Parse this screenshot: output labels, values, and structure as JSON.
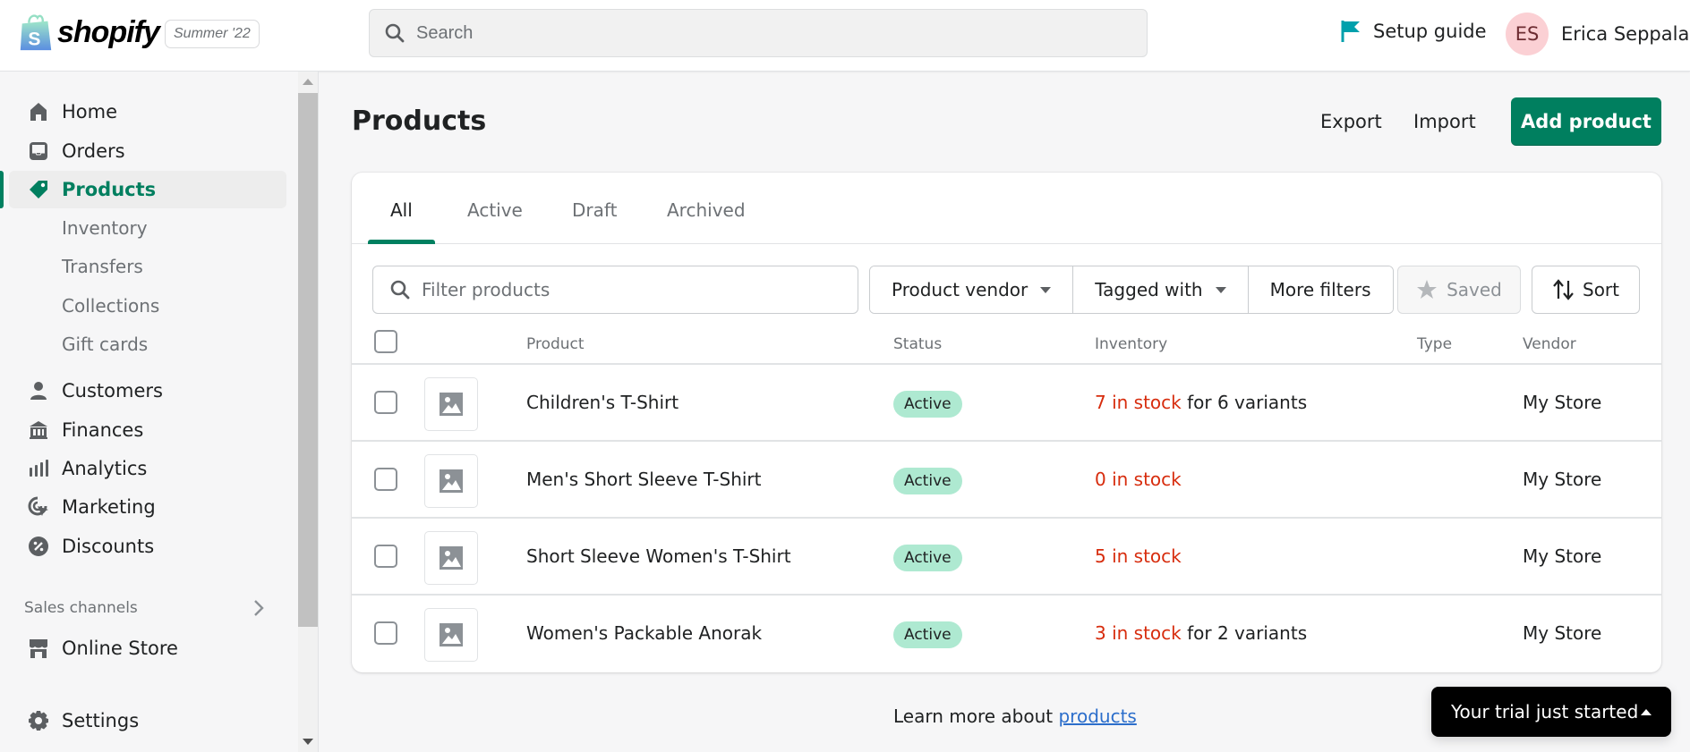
{
  "topbar": {
    "brand": "shopify",
    "version_badge": "Summer '22",
    "search_placeholder": "Search",
    "setup_guide": "Setup guide",
    "user_initials": "ES",
    "user_name": "Erica Seppala"
  },
  "sidebar": {
    "items": [
      {
        "label": "Home",
        "icon": "home-icon"
      },
      {
        "label": "Orders",
        "icon": "orders-icon"
      },
      {
        "label": "Products",
        "icon": "tag-icon",
        "active": true
      },
      {
        "label": "Customers",
        "icon": "person-icon"
      },
      {
        "label": "Finances",
        "icon": "bank-icon"
      },
      {
        "label": "Analytics",
        "icon": "analytics-icon"
      },
      {
        "label": "Marketing",
        "icon": "marketing-icon"
      },
      {
        "label": "Discounts",
        "icon": "discount-icon"
      }
    ],
    "sub_items": [
      "Inventory",
      "Transfers",
      "Collections",
      "Gift cards"
    ],
    "sales_channels_label": "Sales channels",
    "channels": [
      {
        "label": "Online Store",
        "icon": "store-icon"
      }
    ],
    "settings": "Settings"
  },
  "page": {
    "title": "Products",
    "export": "Export",
    "import": "Import",
    "add_product": "Add product"
  },
  "tabs": [
    "All",
    "Active",
    "Draft",
    "Archived"
  ],
  "selected_tab": "All",
  "filters": {
    "placeholder": "Filter products",
    "product_vendor": "Product vendor",
    "tagged_with": "Tagged with",
    "more_filters": "More filters",
    "saved": "Saved",
    "sort": "Sort"
  },
  "table": {
    "columns": [
      "Product",
      "Status",
      "Inventory",
      "Type",
      "Vendor"
    ],
    "rows": [
      {
        "product": "Children's T-Shirt",
        "status": "Active",
        "stock": "7 in stock",
        "variants": " for 6 variants",
        "type": "",
        "vendor": "My Store"
      },
      {
        "product": "Men's Short Sleeve T-Shirt",
        "status": "Active",
        "stock": "0 in stock",
        "variants": "",
        "type": "",
        "vendor": "My Store"
      },
      {
        "product": "Short Sleeve Women's T-Shirt",
        "status": "Active",
        "stock": "5 in stock",
        "variants": "",
        "type": "",
        "vendor": "My Store"
      },
      {
        "product": "Women's Packable Anorak",
        "status": "Active",
        "stock": "3 in stock",
        "variants": " for 2 variants",
        "type": "",
        "vendor": "My Store"
      }
    ]
  },
  "footer": {
    "learn_prefix": "Learn more about ",
    "learn_link": "products"
  },
  "toast": {
    "label": "Your trial just started"
  },
  "colors": {
    "brand_green": "#007f5f",
    "status_active_bg": "#aee9d1",
    "stock_warning": "#d72c0d",
    "link": "#2c6ecb"
  }
}
